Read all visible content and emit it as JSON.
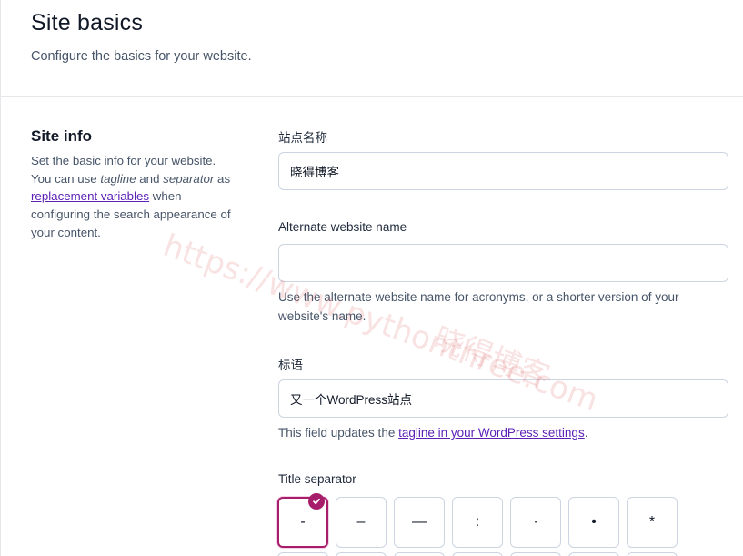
{
  "header": {
    "title": "Site basics",
    "subtitle": "Configure the basics for your website."
  },
  "site_info": {
    "title": "Site info",
    "desc_part1": "Set the basic info for your website. You can use ",
    "desc_tagline": "tagline",
    "desc_and": " and ",
    "desc_separator": "separator",
    "desc_as": " as ",
    "desc_link": "replacement variables",
    "desc_part2": " when configuring the search appearance of your content."
  },
  "fields": {
    "site_name": {
      "label": "站点名称",
      "value": "晓得博客"
    },
    "alt_name": {
      "label": "Alternate website name",
      "value": "",
      "help": "Use the alternate website name for acronyms, or a shorter version of your website's name."
    },
    "tagline": {
      "label": "标语",
      "value": "又一个WordPress站点",
      "help_part1": "This field updates the ",
      "help_link": "tagline in your WordPress settings",
      "help_part2": "."
    }
  },
  "separator": {
    "label": "Title separator",
    "options": [
      "-",
      "–",
      "—",
      ":",
      "·",
      "•",
      "*"
    ],
    "selected_index": 0
  },
  "watermark": {
    "url": "https://www.pythonthree.com",
    "text": "晓得博客"
  },
  "colors": {
    "accent": "#a61e69",
    "link": "#5b21b6",
    "border": "#cbd5e1"
  }
}
